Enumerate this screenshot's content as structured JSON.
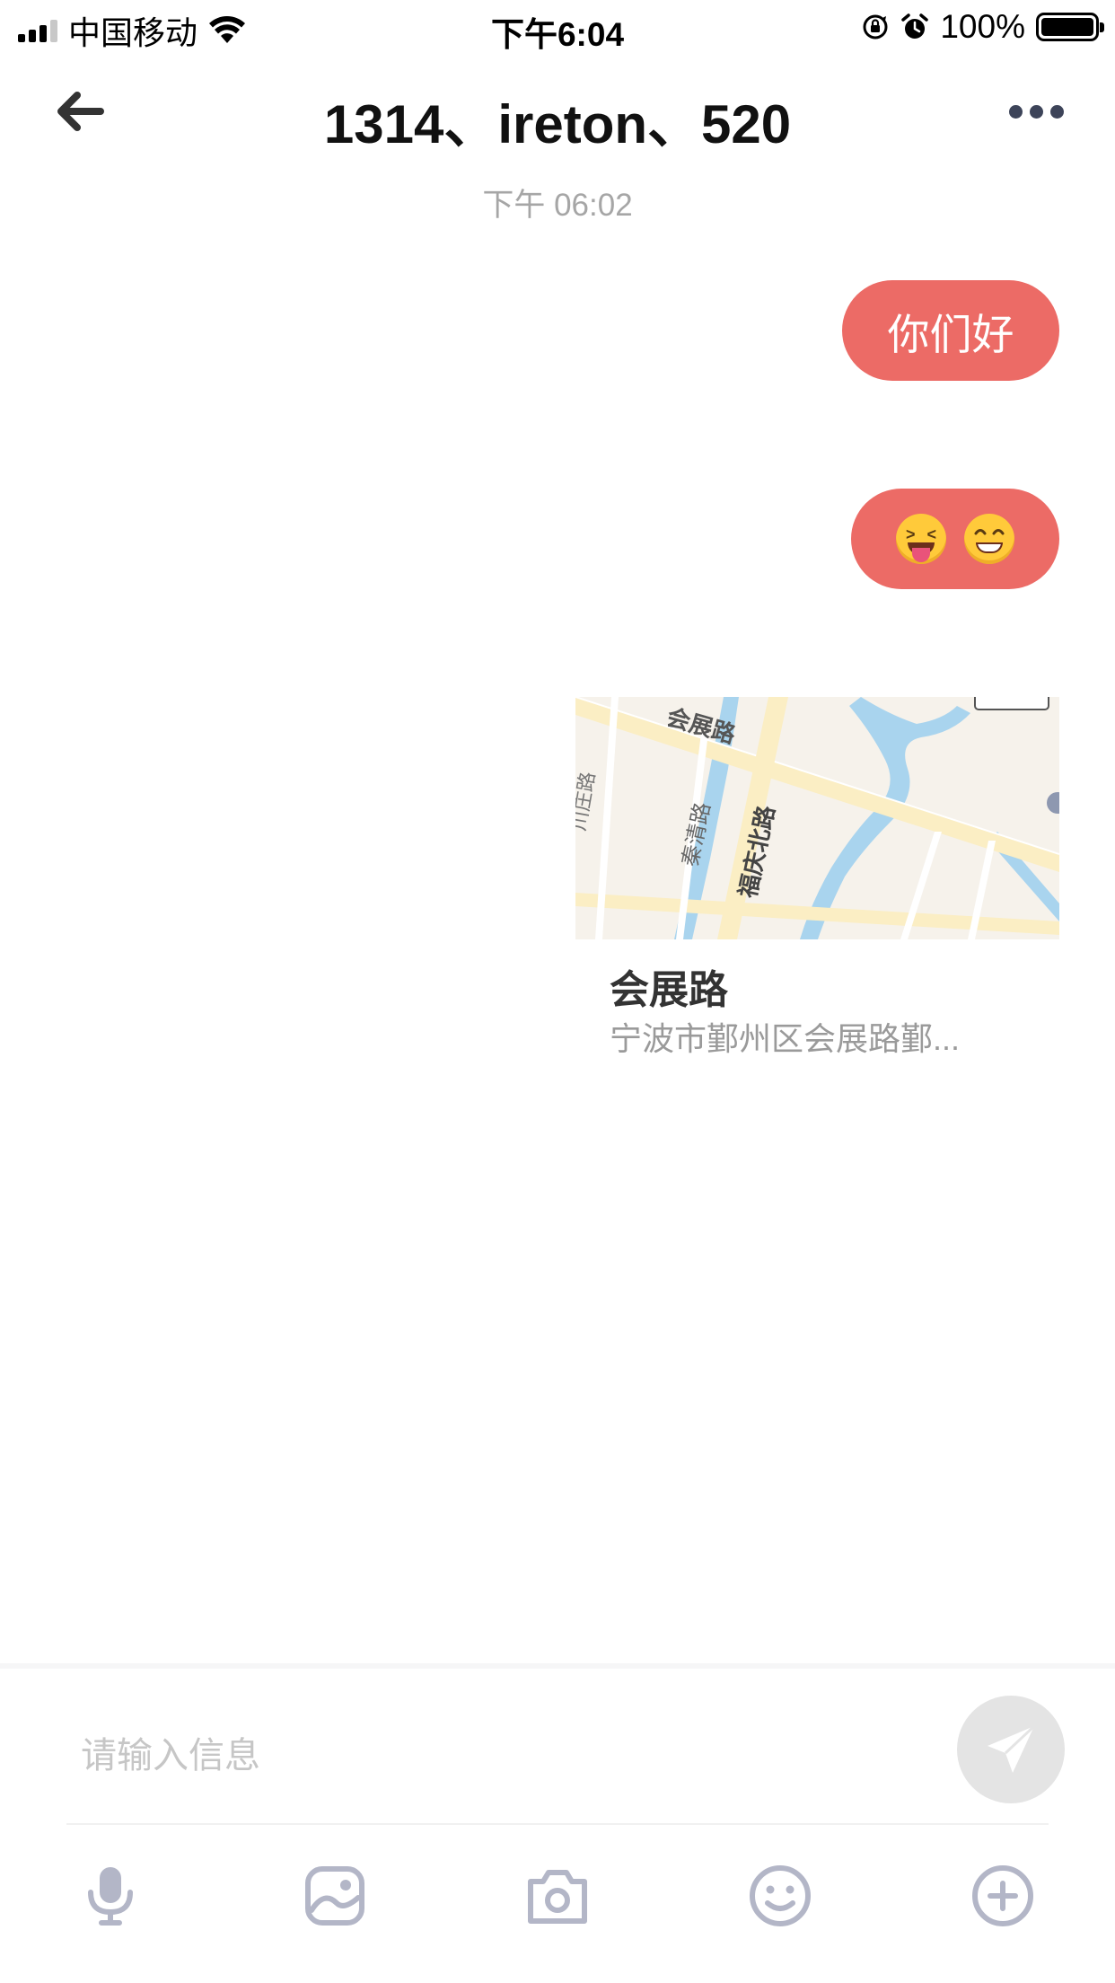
{
  "status_bar": {
    "carrier": "中国移动",
    "time": "下午6:04",
    "battery": "100%",
    "battery_level": 1.0,
    "icons": [
      "signal-icon",
      "wifi-icon",
      "rotation-lock-icon",
      "alarm-icon",
      "battery-icon"
    ]
  },
  "header": {
    "title": "1314、ireton、520",
    "back_icon": "arrow-left-icon",
    "more_icon": "ellipsis-icon"
  },
  "conversation": {
    "timestamp": "下午 06:02",
    "messages": [
      {
        "type": "text",
        "text": "你们好"
      },
      {
        "type": "emoji",
        "emojis": [
          "squinting-face-with-tongue",
          "beaming-face-with-smiling-eyes"
        ]
      },
      {
        "type": "location",
        "title": "会展路",
        "address": "宁波市鄞州区会展路鄞...",
        "map_labels": [
          "会展路",
          "秦清路",
          "福庆北路",
          "川庄路"
        ]
      }
    ]
  },
  "composer": {
    "placeholder": "请输入信息",
    "value": "",
    "send_icon": "paper-plane-icon",
    "tools": [
      "microphone-icon",
      "image-icon",
      "camera-icon",
      "emoji-icon",
      "plus-circle-icon"
    ]
  },
  "colors": {
    "bubble": "#ec6b66",
    "toolbar_icon": "#b3b6c7",
    "send_button_bg": "#e4e4e4",
    "timestamp": "#a6a6a6"
  }
}
